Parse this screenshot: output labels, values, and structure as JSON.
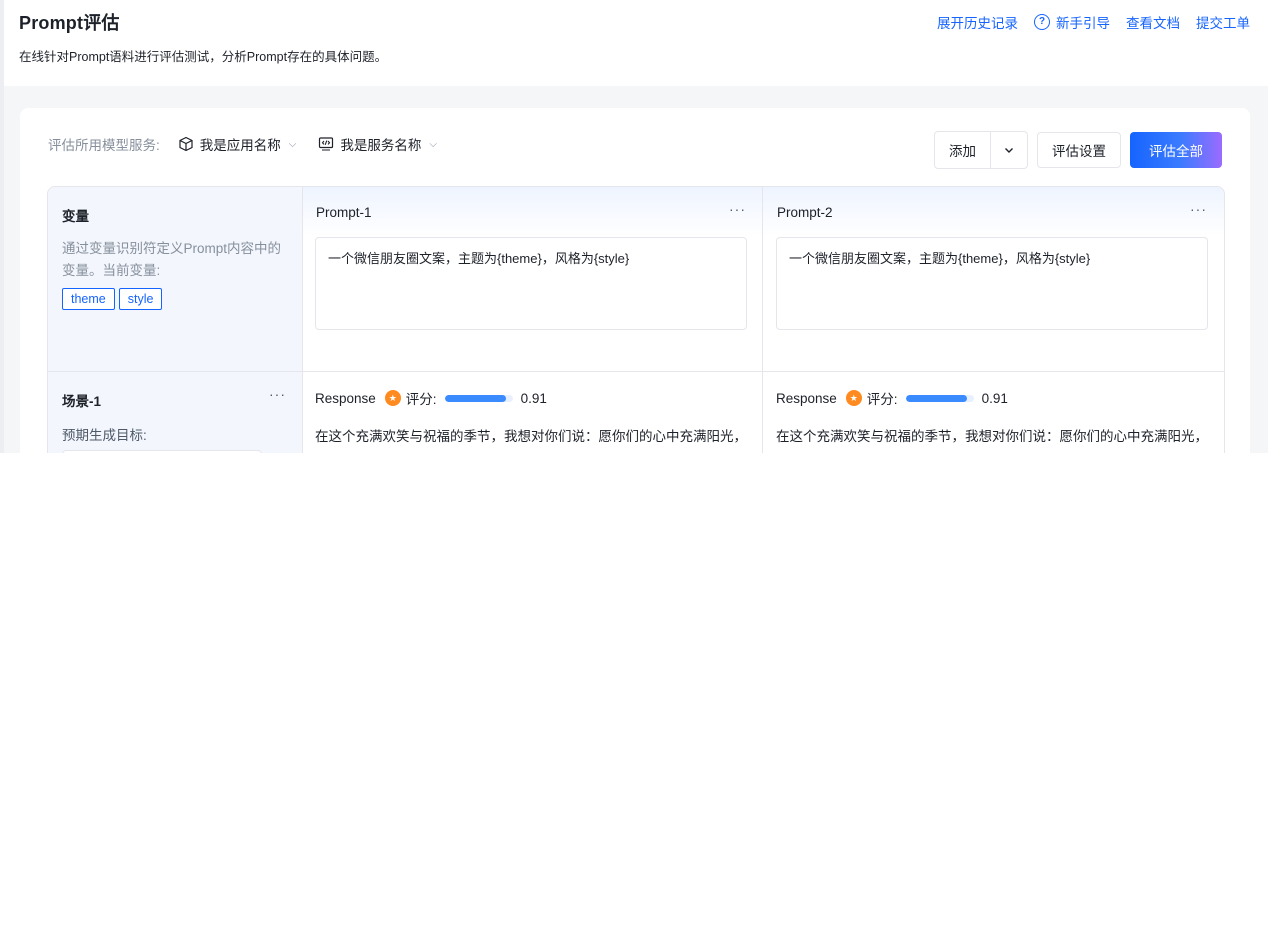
{
  "header": {
    "title": "Prompt评估",
    "subtitle": "在线针对Prompt语料进行评估测试，分析Prompt存在的具体问题。",
    "links": [
      "展开历史记录",
      "新手引导",
      "查看文档",
      "提交工单"
    ],
    "help_icon": "question-circle-icon"
  },
  "toolbar": {
    "model_label": "评估所用模型服务:",
    "app_select": "我是应用名称",
    "service_select": "我是服务名称",
    "add_label": "添加",
    "settings_label": "评估设置",
    "evaluate_all_label": "评估全部"
  },
  "variables": {
    "title": "变量",
    "desc": "通过变量识别符定义Prompt内容中的变量。当前变量:",
    "tags": [
      "theme",
      "style"
    ]
  },
  "prompts": [
    {
      "title": "Prompt-1",
      "text": "一个微信朋友圈文案，主题为{theme}，风格为{style}"
    },
    {
      "title": "Prompt-2",
      "text": "一个微信朋友圈文案，主题为{theme}，风格为{style}"
    }
  ],
  "scene": {
    "title": "场景-1",
    "target_label": "预期生成目标:"
  },
  "responses": [
    {
      "label": "Response",
      "score_label": "评分:",
      "score": 0.91,
      "score_text": "0.91",
      "text": "在这个充满欢笑与祝福的季节，我想对你们说：愿你们的心中充满阳光，如同冬日的暖阳；愿你们的脸上绽放笑容，如同盛开的花朵。在这"
    },
    {
      "label": "Response",
      "score_label": "评分:",
      "score": 0.91,
      "score_text": "0.91",
      "text": "在这个充满欢笑与祝福的季节，我想对你们说：愿你们的心中充满阳光，如同冬日的暖阳；愿你们的脸上绽放笑容，如同盛开的花朵。在这"
    }
  ],
  "colors": {
    "accent": "#1664ff",
    "medal": "#ff8a1f",
    "bar": "#3a8bff"
  }
}
